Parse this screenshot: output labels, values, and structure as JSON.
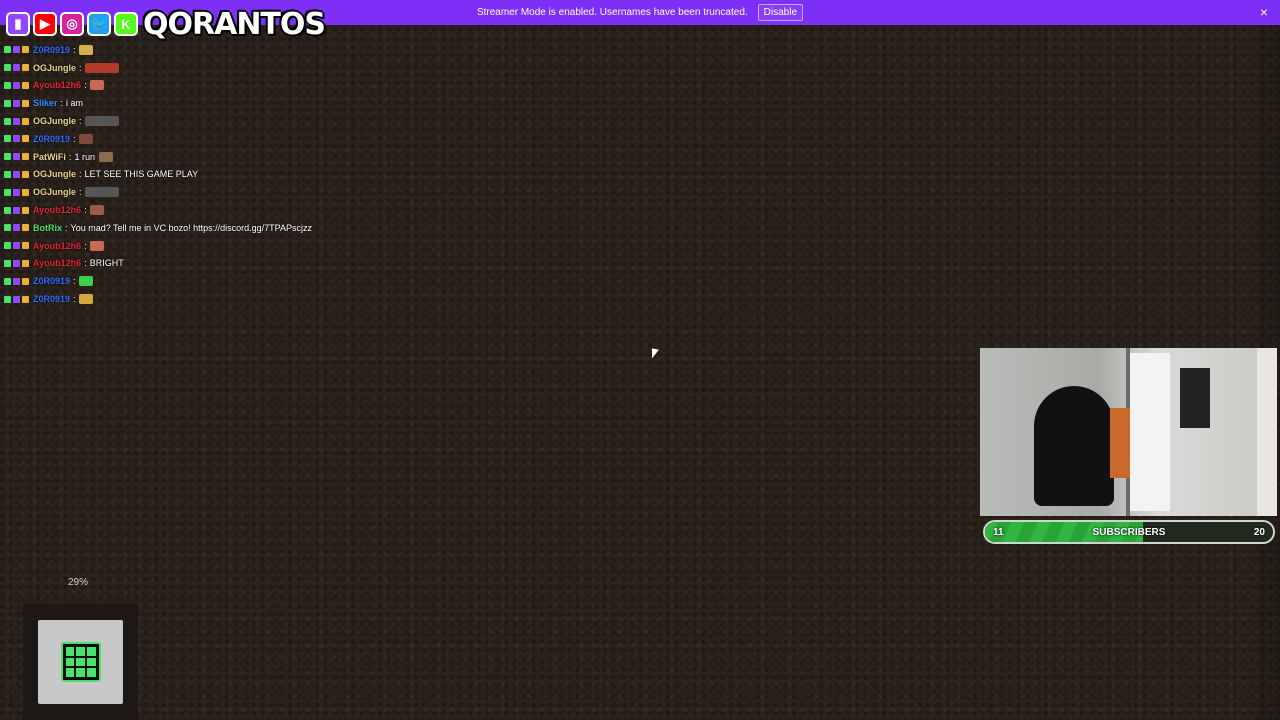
{
  "banner": {
    "message": "Streamer Mode is enabled. Usernames have been truncated.",
    "disable_label": "Disable",
    "close_icon": "×"
  },
  "overlay_logo": {
    "icons": [
      {
        "name": "twitch-icon",
        "glyph": "▮",
        "color": "#9146ff"
      },
      {
        "name": "youtube-icon",
        "glyph": "▶",
        "color": "#ff0000"
      },
      {
        "name": "instagram-icon",
        "glyph": "◎",
        "color": "#d6249f"
      },
      {
        "name": "twitter-icon",
        "glyph": "🐦",
        "color": "#1da1f2"
      },
      {
        "name": "kick-icon",
        "glyph": "K",
        "color": "#53fc18"
      }
    ],
    "name": "QORANTOS"
  },
  "chat": [
    {
      "user": "Z0R0919",
      "color": "#2f6cff",
      "text": "",
      "emote": "#d4b14a",
      "wide": false
    },
    {
      "user": "OGJungle",
      "color": "#e9d28a",
      "text": "",
      "emote": "#b23a2a",
      "wide": true
    },
    {
      "user": "Ayoub12h6",
      "color": "#e0243c",
      "text": "",
      "emote": "#c46a55",
      "wide": false
    },
    {
      "user": "Sliker",
      "color": "#2f8cff",
      "text": "i am",
      "emote": "",
      "wide": false
    },
    {
      "user": "OGJungle",
      "color": "#e9d28a",
      "text": "",
      "emote": "#555555",
      "wide": true
    },
    {
      "user": "Z0R0919",
      "color": "#2f6cff",
      "text": "",
      "emote": "#7a4a3a",
      "wide": false
    },
    {
      "user": "PatWiFi",
      "color": "#e9d28a",
      "text": "1 run",
      "emote": "#8b6b4e",
      "wide": false
    },
    {
      "user": "OGJungle",
      "color": "#e9d28a",
      "text": "LET SEE THIS GAME PLAY",
      "emote": "",
      "wide": false
    },
    {
      "user": "OGJungle",
      "color": "#e9d28a",
      "text": "",
      "emote": "#555555",
      "wide": true
    },
    {
      "user": "Ayoub12h6",
      "color": "#e0243c",
      "text": "",
      "emote": "#9a5a4a",
      "wide": false
    },
    {
      "user": "BotRix",
      "color": "#49e36a",
      "text": "You mad? Tell me in VC bozo! https://discord.gg/7TPAPscjzz",
      "emote": "",
      "wide": false
    },
    {
      "user": "Ayoub12h6",
      "color": "#e0243c",
      "text": "",
      "emote": "#c46a55",
      "wide": false
    },
    {
      "user": "Ayoub12h6",
      "color": "#e0243c",
      "text": "BRIGHT",
      "emote": "",
      "wide": false
    },
    {
      "user": "Z0R0919",
      "color": "#2f6cff",
      "text": "",
      "emote": "#3fd04a",
      "wide": false
    },
    {
      "user": "Z0R0919",
      "color": "#2f6cff",
      "text": "",
      "emote": "#d4a93a",
      "wide": false
    }
  ],
  "subscriber_goal": {
    "current": "11",
    "label": "SUBSCRIBERS",
    "goal": "20",
    "fraction": 0.55
  },
  "hud": {
    "percent": "29%"
  }
}
